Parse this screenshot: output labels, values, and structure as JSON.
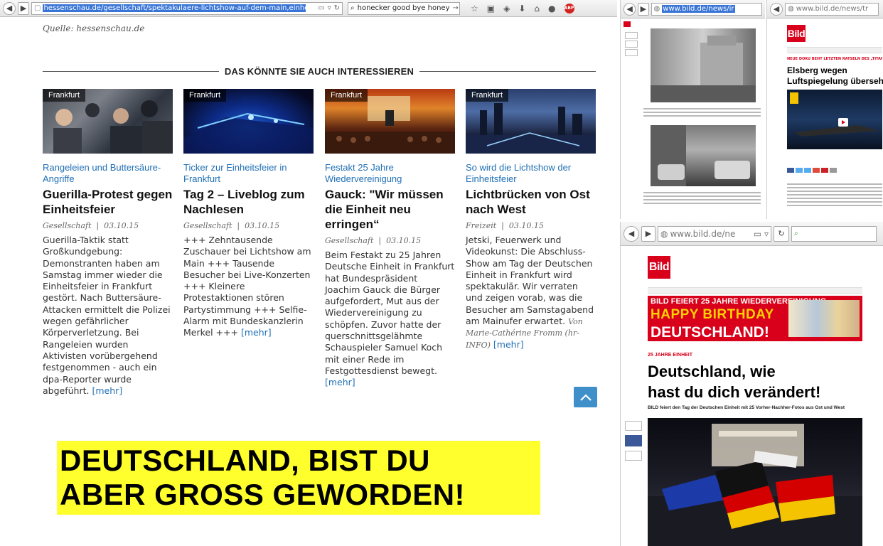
{
  "browser": {
    "url": "hessenschau.de/gesellschaft/spektakulaere-lichtshow-auf-dem-main,einheit-lichtshow-samst",
    "search_query": "honecker good bye honey",
    "adblock_label": "ABP"
  },
  "page": {
    "source": "Quelle: hessenschau.de",
    "section_title": "DAS KÖNNTE SIE AUCH INTERESSIEREN",
    "articles": [
      {
        "tag": "Frankfurt",
        "kicker": "Rangeleien und Buttersäure-Angriffe",
        "headline": "Guerilla-Protest gegen Einheitsfeier",
        "category": "Gesellschaft",
        "date": "03.10.15",
        "teaser": "Guerilla-Taktik statt Großkundgebung: Demonstranten haben am Samstag immer wieder die Einheitsfeier in Frankfurt gestört. Nach Buttersäure-Attacken ermittelt die Polizei wegen gefährlicher Körperverletzung. Bei Rangeleien wurden Aktivisten vorübergehend festgenommen - auch ein dpa-Reporter wurde abgeführt.",
        "more": "[mehr]",
        "author": ""
      },
      {
        "tag": "Frankfurt",
        "kicker": "Ticker zur Einheitsfeier in Frankfurt",
        "headline": "Tag 2 – Liveblog zum Nachlesen",
        "category": "Gesellschaft",
        "date": "03.10.15",
        "teaser": "+++ Zehntausende Zuschauer bei Lichtshow am Main +++ Tausende Besucher bei Live-Konzerten +++ Kleinere Protestaktionen stören Partystimmung +++ Selfie-Alarm mit Bundeskanzlerin Merkel +++",
        "more": "[mehr]",
        "author": ""
      },
      {
        "tag": "Frankfurt",
        "kicker": "Festakt 25 Jahre Wiedervereinigung",
        "headline": "Gauck: \"Wir müssen die Einheit neu erringen“",
        "category": "Gesellschaft",
        "date": "03.10.15",
        "teaser": "Beim Festakt zu 25 Jahren Deutsche Einheit in Frankfurt hat Bundespräsident Joachim Gauck die Bürger aufgefordert, Mut aus der Wiedervereinigung zu schöpfen. Zuvor hatte der querschnittsgelähmte Schauspieler Samuel Koch mit einer Rede im Festgottesdienst bewegt.",
        "more": "[mehr]",
        "author": ""
      },
      {
        "tag": "Frankfurt",
        "kicker": "So wird die Lichtshow der Einheitsfeier",
        "headline": "Lichtbrücken von Ost nach West",
        "category": "Freizeit",
        "date": "03.10.15",
        "teaser": "Jetski, Feuerwerk und Videokunst: Die Abschluss-Show am Tag der Deutschen Einheit in Frankfurt wird spektakulär. Wir verraten und zeigen vorab, was die Besucher am Samstagabend am Mainufer erwartet.",
        "more": "[mehr]",
        "author": "Von Marie-Cathérine Fromm (hr-INFO)"
      }
    ]
  },
  "caption": {
    "line1": "DEUTSCHLAND, BIST DU",
    "line2": "ABER GROSS GEWORDEN!"
  },
  "right": {
    "pane1_url": "www.bild.de/news/ir",
    "pane2_url": "www.bild.de/news/tr",
    "pane2_logo": "Bild",
    "pane2_kicker": "NEUE DOKU BEHT LETZTEN RÄTSELN DES „TITANIC“-UNTER DEN GRUND",
    "pane2_headline_1": "Elsberg wegen",
    "pane2_headline_2": "Luftspiegelung überseh",
    "pane3_url": "www.bild.de/ne",
    "pane3_logo": "Bild",
    "banner_top": "FEIERT 25 JAHRE WIEDERVEREINIGUNG",
    "banner_brand": "BILD",
    "banner_line1": "HAPPY BIRTHDAY",
    "banner_line2": "DEUTSCHLAND!",
    "kicker": "25 JAHRE EINHEIT",
    "headline_1": "Deutschland, wie",
    "headline_2": "hast du dich verändert!",
    "subline": "BILD feiert den Tag der Deutschen Einheit mit 25 Vorher-Nachher-Fotos aus Ost und West"
  },
  "colors": {
    "accent_blue": "#1f6fb4",
    "bild_red": "#d8001b",
    "caption_yellow": "#ffff2e",
    "banner_yellow": "#ffd200"
  },
  "icons": [
    "back-icon",
    "forward-icon",
    "reader-icon",
    "dropdown-icon",
    "reload-icon",
    "search-icon",
    "star-icon",
    "clipboard-icon",
    "shield-icon",
    "download-icon",
    "home-icon",
    "chat-icon",
    "adblock-icon",
    "arrow-up-icon"
  ]
}
